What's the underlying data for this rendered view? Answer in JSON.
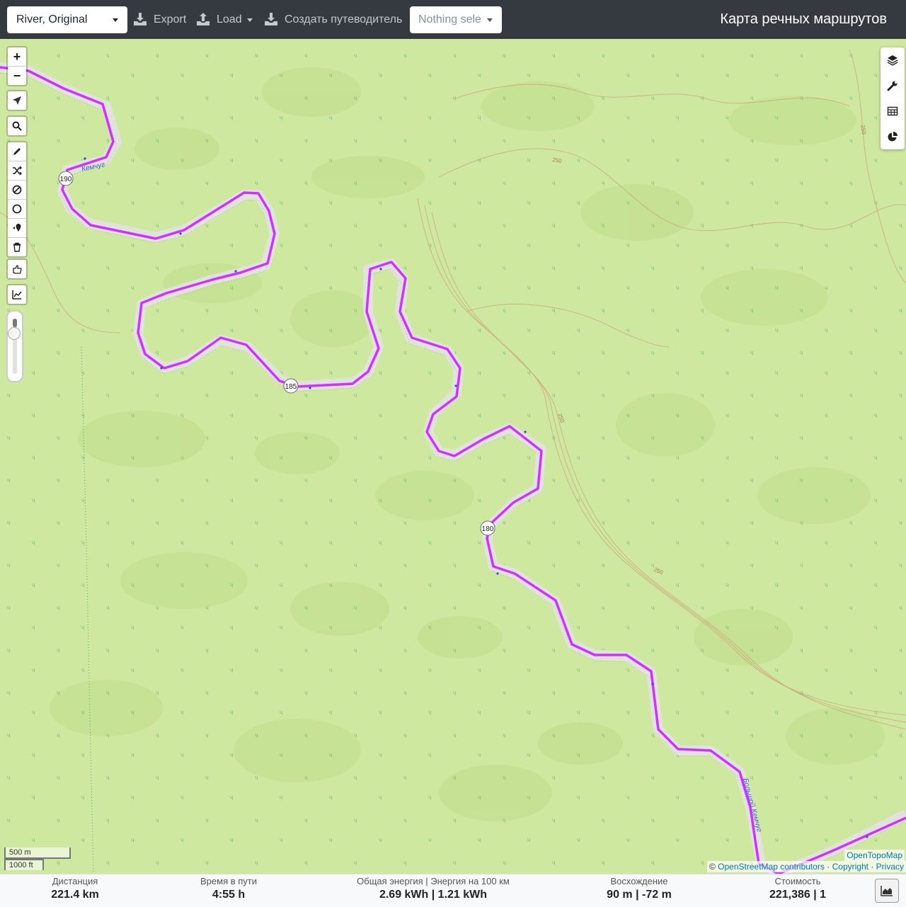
{
  "navbar": {
    "profile": "River, Original",
    "export_label": "Export",
    "load_label": "Load",
    "guide_label": "Создать путеводитель",
    "route_placeholder": "Nothing sele",
    "brand": "Карта речных маршрутов"
  },
  "map": {
    "labels": {
      "km190": "190",
      "km185": "185",
      "km180": "180",
      "river_kemchug": "Кемчуг",
      "river_big_kemchug": "Большой Кемчуг",
      "contour_250": "250"
    },
    "scale_metric": "500 m",
    "scale_imperial": "1000 ft",
    "attribution_top": "OpenTopoMap",
    "attribution": {
      "prefix": "©",
      "osm": "OpenStreetMap contributors",
      "sep1": "·",
      "copyright": "Copyright",
      "sep2": "·",
      "privacy": "Privacy"
    },
    "zoom_in": "+",
    "zoom_out": "−"
  },
  "stats": {
    "distance_title": "Дистанция",
    "distance_value": "221.4 km",
    "time_title": "Время в пути",
    "time_value": "4:55 h",
    "energy_title": "Общая энергия | Энергия на 100 км",
    "energy_value": "2.69 kWh | 1.21 kWh",
    "ascent_title": "Восхождение",
    "ascent_value": "90 m | -72 m",
    "cost_title": "Стоимость",
    "cost_value": "221,386 | 1"
  },
  "colors": {
    "route": "#cc33ff",
    "river": "#e3e3df",
    "terrain": "#cfe8a0",
    "contour": "#c9a27a",
    "navbar": "#343a40"
  }
}
